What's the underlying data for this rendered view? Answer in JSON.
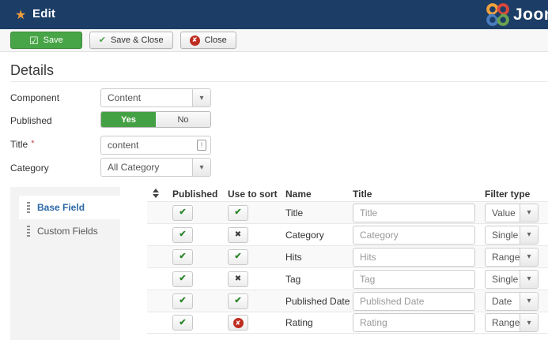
{
  "titlebar": {
    "title": "Edit",
    "logo_text": "Joomla"
  },
  "toolbar": {
    "save_label": "Save",
    "save_close_label": "Save & Close",
    "close_label": "Close"
  },
  "icons": {
    "star": "★",
    "save_apply": "☑",
    "save_close_check": "✔",
    "close_x": "✘",
    "caret": "▾",
    "title_field_flag": "!"
  },
  "details": {
    "heading": "Details",
    "fields": {
      "component": {
        "label": "Component",
        "value": "Content"
      },
      "published": {
        "label": "Published",
        "yes": "Yes",
        "no": "No",
        "selected": "Yes"
      },
      "title": {
        "label": "Title",
        "required_mark": "*",
        "value": "content"
      },
      "category": {
        "label": "Category",
        "value": "All Category"
      }
    }
  },
  "sidebar": {
    "tabs": [
      {
        "label": "Base Field",
        "active": true
      },
      {
        "label": "Custom Fields",
        "active": false
      }
    ]
  },
  "table": {
    "headers": {
      "published": "Published",
      "use_to_sort": "Use to sort",
      "name": "Name",
      "title": "Title",
      "filter_type": "Filter type"
    },
    "rows": [
      {
        "name": "Title",
        "title": "Title",
        "filter": "Value",
        "published": "check",
        "sort": "check"
      },
      {
        "name": "Category",
        "title": "Category",
        "filter": "Single",
        "published": "check",
        "sort": "x"
      },
      {
        "name": "Hits",
        "title": "Hits",
        "filter": "Range",
        "published": "check",
        "sort": "check"
      },
      {
        "name": "Tag",
        "title": "Tag",
        "filter": "Single",
        "published": "check",
        "sort": "x"
      },
      {
        "name": "Published Date",
        "title": "Published Date",
        "filter": "Date",
        "published": "check",
        "sort": "check"
      },
      {
        "name": "Rating",
        "title": "Rating",
        "filter": "Range",
        "published": "check",
        "sort": "ban"
      }
    ]
  },
  "colors": {
    "header_navy": "#1c3d66",
    "brand_green": "#46a046",
    "active_tab_blue": "#2a69a5",
    "danger_red": "#bf2c20",
    "star_orange": "#eb9c3c",
    "row_stripe": "#f9f9f9"
  }
}
